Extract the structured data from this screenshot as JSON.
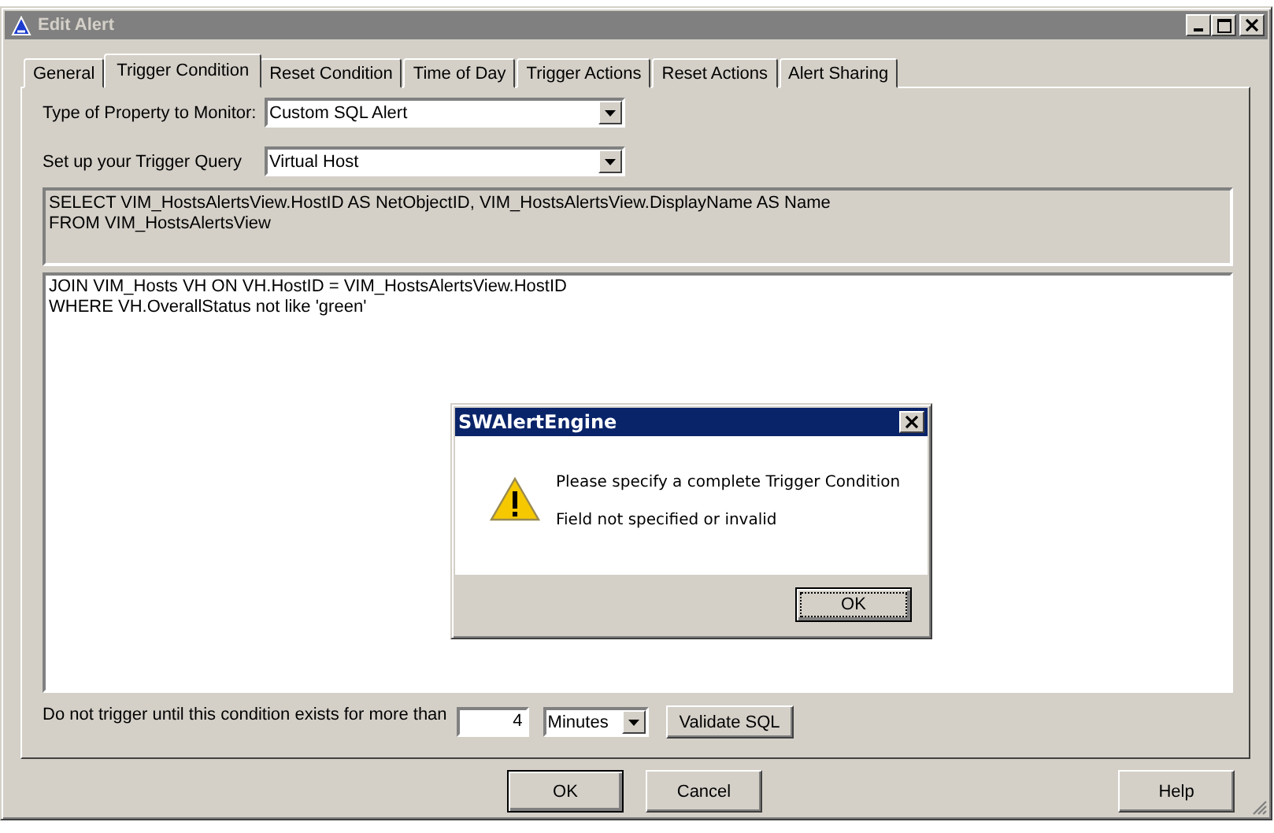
{
  "window": {
    "title": "Edit Alert"
  },
  "tabs": [
    {
      "label": "General",
      "selected": false
    },
    {
      "label": "Trigger Condition",
      "selected": true
    },
    {
      "label": "Reset Condition",
      "selected": false
    },
    {
      "label": "Time of Day",
      "selected": false
    },
    {
      "label": "Trigger Actions",
      "selected": false
    },
    {
      "label": "Reset Actions",
      "selected": false
    },
    {
      "label": "Alert Sharing",
      "selected": false
    }
  ],
  "property_type": {
    "label": "Type of Property to Monitor:",
    "value": "Custom SQL Alert"
  },
  "trigger_query": {
    "label": "Set up your Trigger Query",
    "value": "Virtual Host"
  },
  "sql_select": {
    "lines": [
      "SELECT VIM_HostsAlertsView.HostID AS NetObjectID, VIM_HostsAlertsView.DisplayName AS Name",
      "FROM VIM_HostsAlertsView"
    ]
  },
  "sql_where": {
    "lines": [
      "JOIN VIM_Hosts VH ON VH.HostID = VIM_HostsAlertsView.HostID",
      "WHERE VH.OverallStatus not like 'green'"
    ]
  },
  "duration": {
    "label": "Do not trigger until this condition exists for more than",
    "value": "4",
    "unit": "Minutes"
  },
  "validate_button": "Validate SQL",
  "buttons": [
    {
      "label": "OK",
      "kind": "default"
    },
    {
      "label": "Cancel",
      "kind": "normal"
    },
    {
      "label": "Help",
      "kind": "help"
    }
  ],
  "dialog": {
    "title": "SWAlertEngine",
    "message": "Please specify a complete Trigger Condition",
    "detail": "Field not specified or invalid",
    "button": "OK"
  }
}
